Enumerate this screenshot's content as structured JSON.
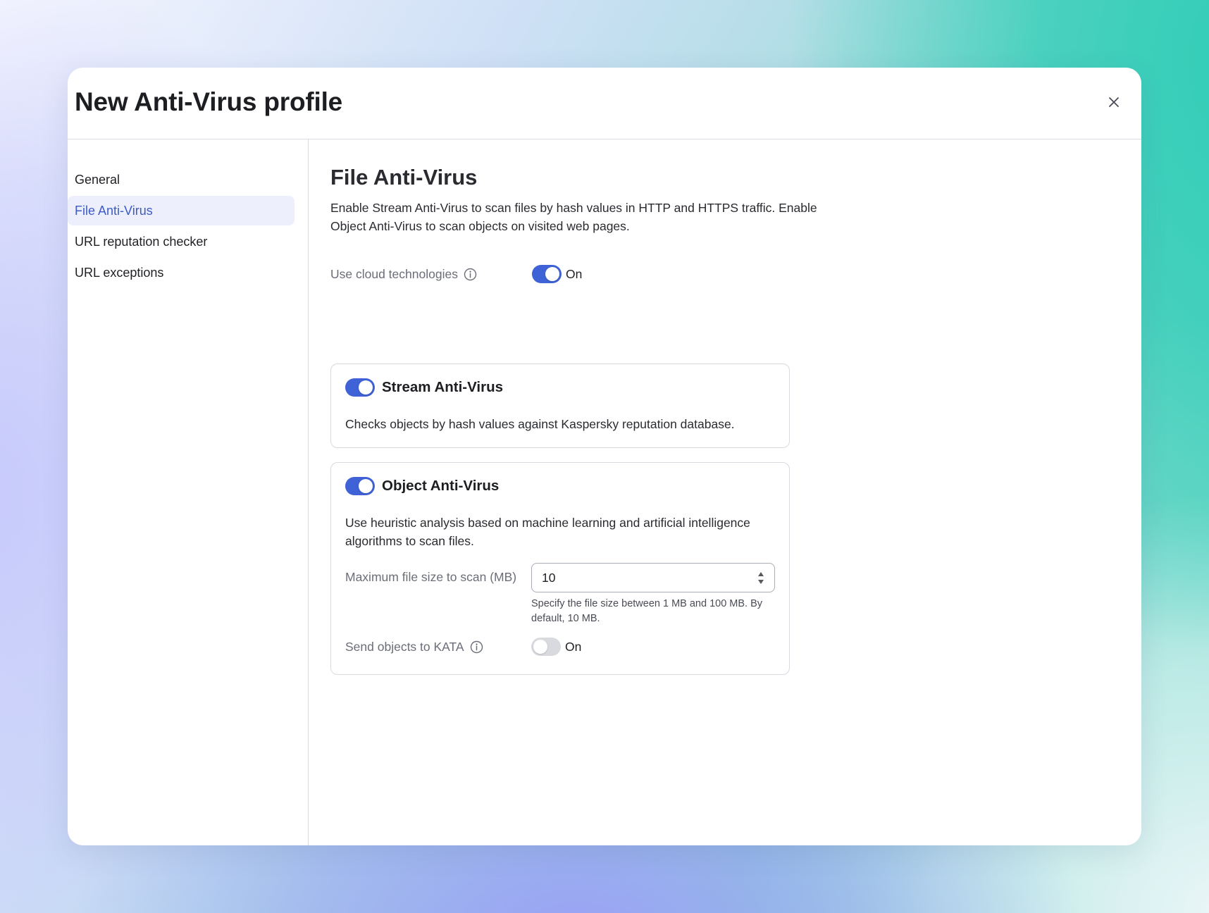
{
  "dialog": {
    "title": "New Anti-Virus profile",
    "close_label": "×"
  },
  "sidebar": {
    "items": [
      {
        "label": "General",
        "active": false
      },
      {
        "label": "File Anti-Virus",
        "active": true
      },
      {
        "label": "URL reputation checker",
        "active": false
      },
      {
        "label": "URL exceptions",
        "active": false
      }
    ]
  },
  "main": {
    "title": "File Anti-Virus",
    "description": "Enable Stream Anti-Virus to scan files by hash values in HTTP and HTTPS traffic. Enable Object Anti-Virus to scan objects on visited web pages.",
    "cloud": {
      "label": "Use cloud technologies",
      "state_text": "On",
      "enabled": true
    },
    "stream_card": {
      "title": "Stream Anti-Virus",
      "description": "Checks objects by hash values against Kaspersky reputation database.",
      "enabled": true
    },
    "object_card": {
      "title": "Object Anti-Virus",
      "description": "Use heuristic analysis based on machine learning and artificial intelligence algorithms to scan files.",
      "enabled": true,
      "max_size_label": "Maximum file size to scan (MB)",
      "max_size_value": "10",
      "max_size_hint": "Specify the file size between 1 MB and 100 MB. By default, 10 MB.",
      "kata_label": "Send objects to KATA",
      "kata_state_text": "On",
      "kata_enabled": false
    }
  },
  "colors": {
    "accent": "#3f62d6",
    "active_nav_bg": "#edf0fc",
    "active_nav_text": "#3c5bc7",
    "toggle_off": "#d8dae0"
  },
  "icons": {
    "close": "close-icon",
    "info": "info-icon",
    "stepper": "stepper-arrows-icon"
  }
}
